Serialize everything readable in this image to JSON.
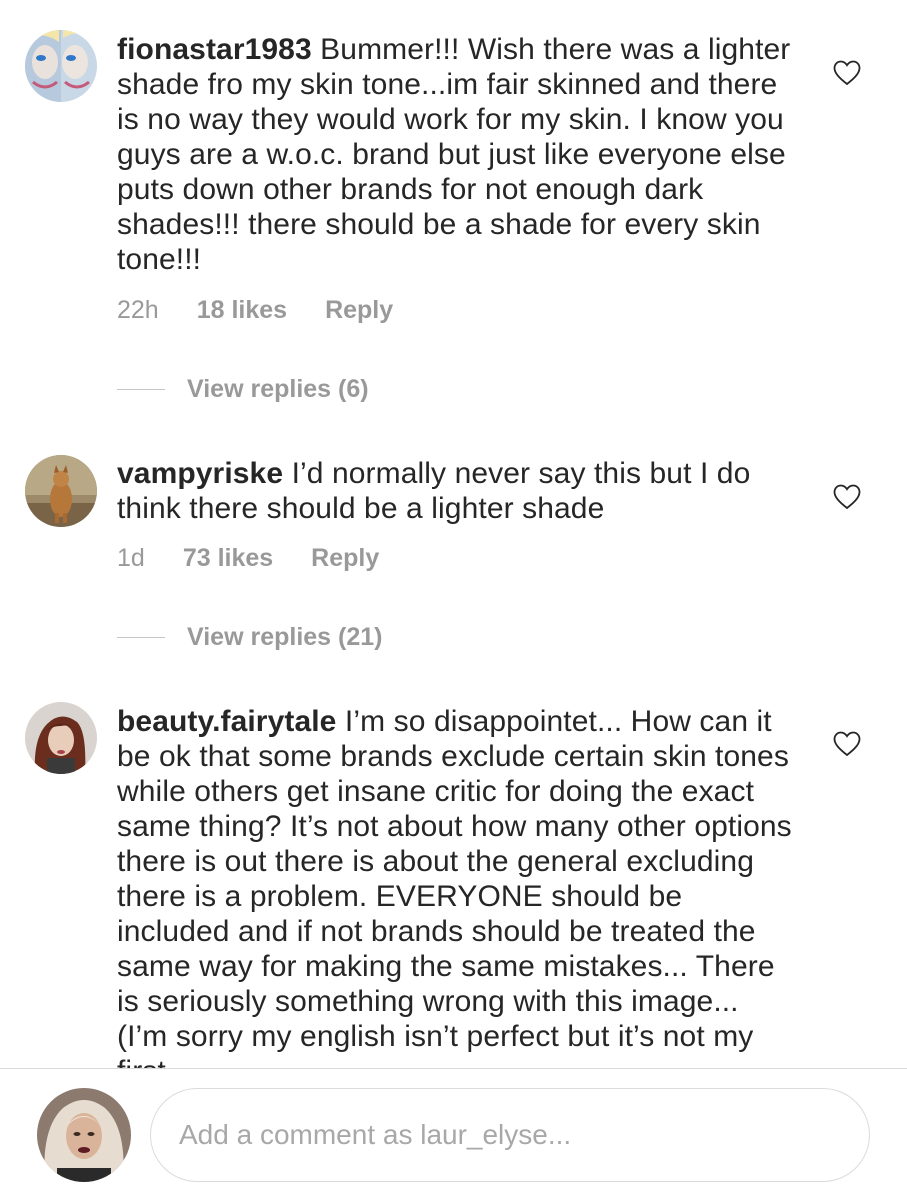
{
  "comments": [
    {
      "username": "fionastar1983",
      "text": "Bummer!!! Wish there was a lighter shade fro my skin tone...im fair skinned and there is no way they would work for my skin. I know you guys are a w.o.c. brand but just like everyone else puts down other brands for not enough dark shades!!! there should be a shade for every skin tone!!!",
      "time": "22h",
      "likes": "18 likes",
      "reply": "Reply",
      "view_replies": "View replies (6)"
    },
    {
      "username": "vampyriske",
      "text": "I’d normally never say this but I do think there should be a lighter shade",
      "time": "1d",
      "likes": "73 likes",
      "reply": "Reply",
      "view_replies": "View replies (21)"
    },
    {
      "username": "beauty.fairytale",
      "text": "I’m so disappointet... How can it be ok that some brands exclude certain skin tones while others get insane critic for doing the exact same thing? It’s not about how many other options there is out there is about the general excluding there is a problem. EVERYONE should be included and if not brands should be treated the same way for making the same mistakes... There is seriously something wrong with this image... (I’m sorry my english isn’t perfect but it’s not my first",
      "time": "",
      "likes": "",
      "reply": "",
      "view_replies": ""
    }
  ],
  "composer": {
    "placeholder": "Add a comment as laur_elyse..."
  },
  "colors": {
    "text": "#262626",
    "meta": "#999999",
    "divider": "#dbdbdb"
  },
  "icons": {
    "like": "heart-outline-icon"
  }
}
